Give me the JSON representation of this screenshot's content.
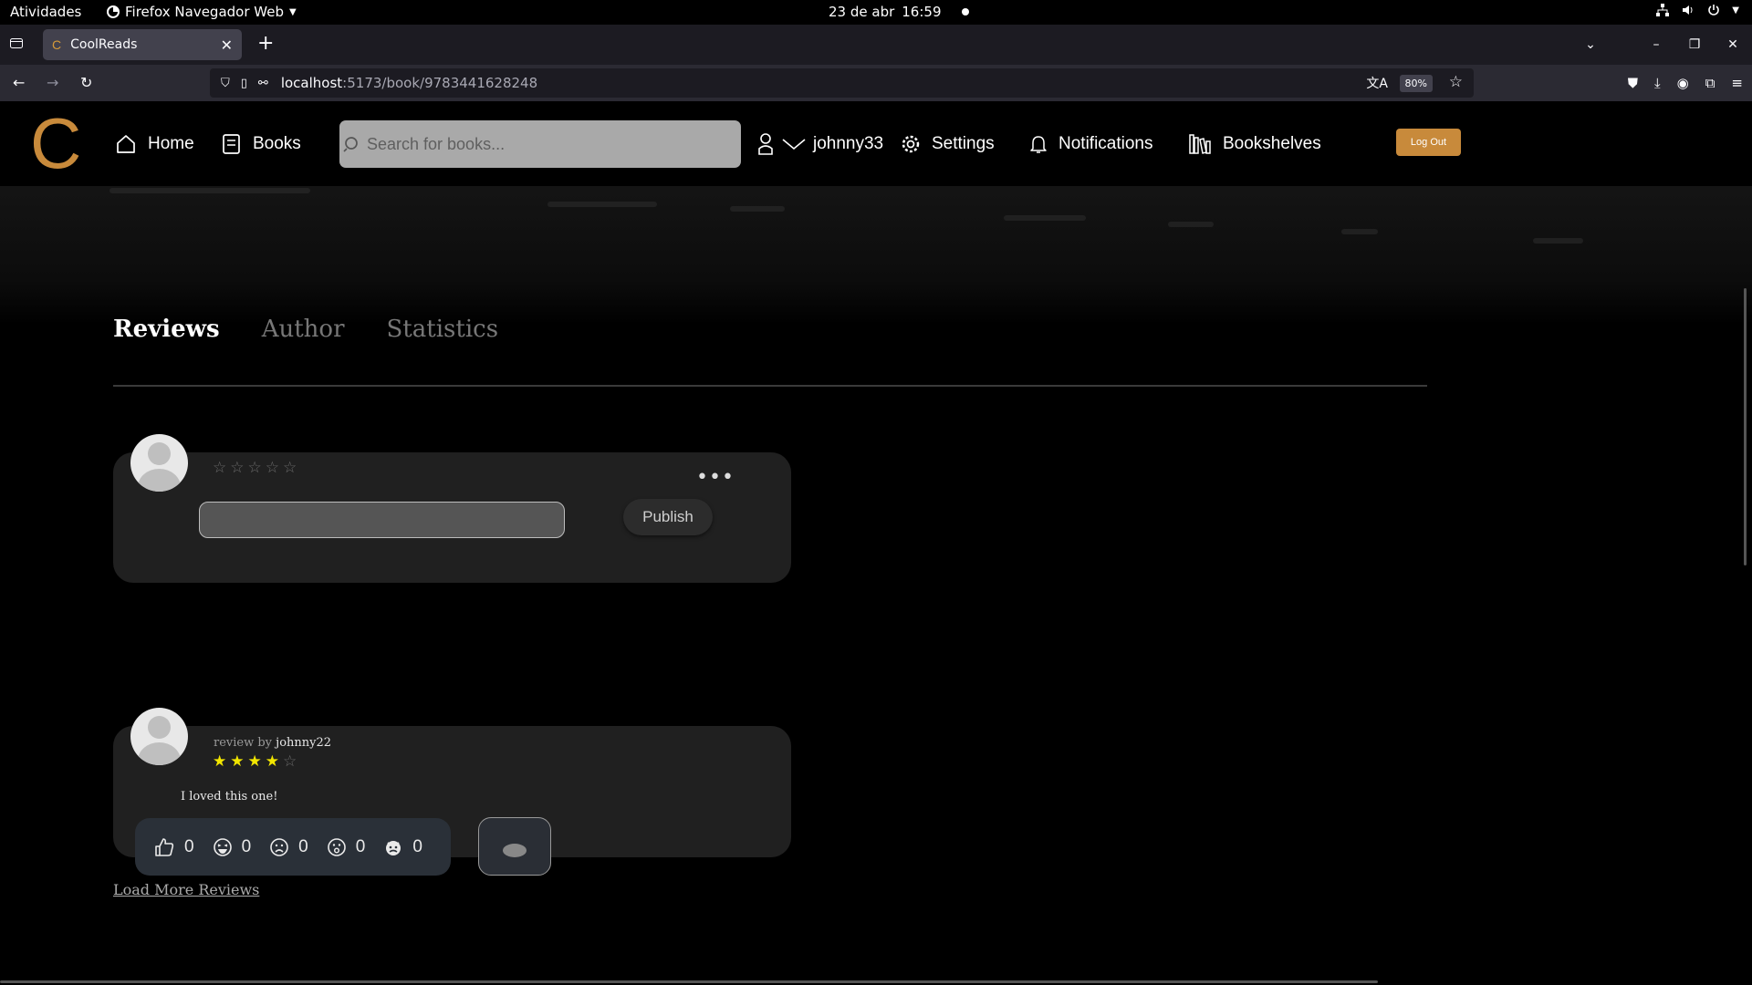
{
  "system_bar": {
    "activities": "Atividades",
    "app_name": "Firefox Navegador Web",
    "date": "23 de abr",
    "time": "16:59"
  },
  "browser": {
    "tab_title": "CoolReads",
    "tab_favicon": "C",
    "url_host": "localhost",
    "url_path": ":5173/book/9783441628248",
    "zoom": "80%"
  },
  "header": {
    "logo": "C",
    "nav": {
      "home": "Home",
      "books": "Books",
      "username": "johnny33",
      "settings": "Settings",
      "notifications": "Notifications",
      "bookshelves": "Bookshelves"
    },
    "search_placeholder": "Search for books...",
    "logout": "Log Out"
  },
  "tabs": {
    "reviews": "Reviews",
    "author": "Author",
    "statistics": "Statistics",
    "active": "reviews"
  },
  "new_review": {
    "rating": 0,
    "max_rating": 5,
    "publish_label": "Publish",
    "more_label": "•••"
  },
  "reviews": [
    {
      "byline_prefix": "review by",
      "user": "johnny22",
      "rating": 4,
      "max_rating": 5,
      "text": "I loved this one!",
      "reactions": {
        "like": "0",
        "laugh": "0",
        "sad": "0",
        "wow": "0",
        "angry": "0"
      }
    }
  ],
  "load_more": "Load More Reviews",
  "colors": {
    "accent": "#c88a3b",
    "star_filled": "#f2e600",
    "card_bg": "#202020"
  }
}
